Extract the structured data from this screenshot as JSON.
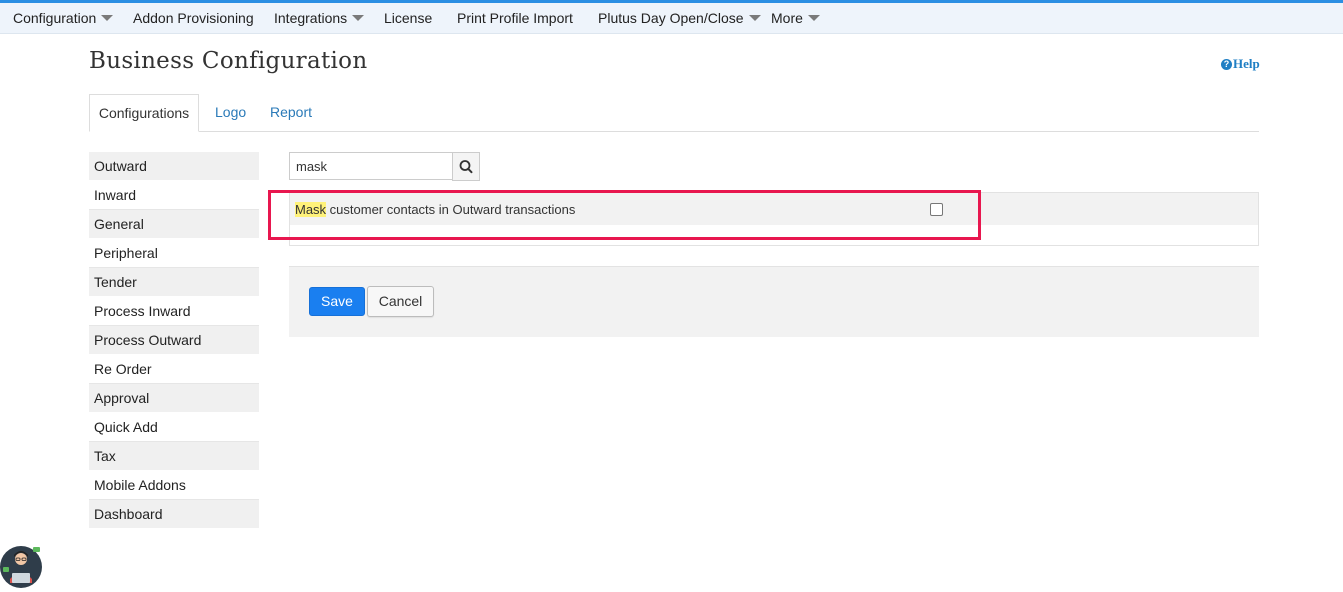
{
  "topnav": {
    "items": [
      {
        "label": "Configuration",
        "dropdown": true
      },
      {
        "label": "Addon Provisioning",
        "dropdown": false
      },
      {
        "label": "Integrations",
        "dropdown": true
      },
      {
        "label": "License",
        "dropdown": false
      },
      {
        "label": "Print Profile Import",
        "dropdown": false
      },
      {
        "label": "Plutus Day Open/Close",
        "dropdown": true
      },
      {
        "label": "More",
        "dropdown": true
      }
    ]
  },
  "header": {
    "title": "Business Configuration",
    "help_label": "Help"
  },
  "tabs": [
    {
      "label": "Configurations",
      "active": true
    },
    {
      "label": "Logo",
      "active": false
    },
    {
      "label": "Report",
      "active": false
    }
  ],
  "sidebar": {
    "items": [
      {
        "label": "Outward"
      },
      {
        "label": "Inward"
      },
      {
        "label": "General"
      },
      {
        "label": "Peripheral"
      },
      {
        "label": "Tender"
      },
      {
        "label": "Process Inward"
      },
      {
        "label": "Process Outward"
      },
      {
        "label": "Re Order"
      },
      {
        "label": "Approval"
      },
      {
        "label": "Quick Add"
      },
      {
        "label": "Tax"
      },
      {
        "label": "Mobile Addons"
      },
      {
        "label": "Dashboard"
      }
    ]
  },
  "search": {
    "value": "mask",
    "icon": "search-icon"
  },
  "results": [
    {
      "match": "Mask",
      "rest": " customer contacts in Outward transactions",
      "checked": false
    }
  ],
  "actions": {
    "save_label": "Save",
    "cancel_label": "Cancel"
  },
  "colors": {
    "accent": "#2b8fe3",
    "primary_button": "#1a7ff0",
    "annotation_box": "#e8174f",
    "search_highlight": "#fff27a"
  }
}
